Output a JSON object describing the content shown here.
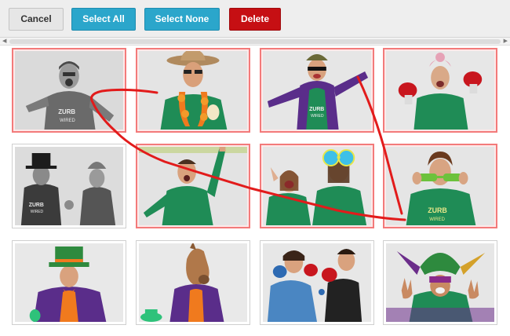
{
  "toolbar": {
    "cancel_label": "Cancel",
    "select_all_label": "Select All",
    "select_none_label": "Select None",
    "delete_label": "Delete"
  },
  "colors": {
    "accent_blue": "#2ba6cb",
    "danger_red": "#c60f13",
    "selection_border": "#f37a7a",
    "selection_bg": "#fde9e9",
    "drag_path": "#e21b1b"
  },
  "photos": [
    {
      "name": "man-gray-shirt-shouting",
      "selected": true,
      "text": "ZURB WIRED"
    },
    {
      "name": "man-cowboy-hat-leis",
      "selected": true,
      "text": ""
    },
    {
      "name": "man-purple-jacket-hat",
      "selected": true,
      "text": "ZURB WIRED"
    },
    {
      "name": "woman-boxing-gloves",
      "selected": true,
      "text": ""
    },
    {
      "name": "two-people-top-hats-bw",
      "selected": false,
      "text": "ZURB WIRED"
    },
    {
      "name": "man-pointing-green-shirt",
      "selected": true,
      "text": ""
    },
    {
      "name": "two-women-big-sunglasses",
      "selected": true,
      "text": ""
    },
    {
      "name": "man-green-glasses",
      "selected": true,
      "text": "ZURB WIRED"
    },
    {
      "name": "man-green-top-hat-purple-suit",
      "selected": false,
      "text": ""
    },
    {
      "name": "horse-mask-purple-suit",
      "selected": false,
      "text": ""
    },
    {
      "name": "two-people-boxing",
      "selected": false,
      "text": ""
    },
    {
      "name": "woman-jester-hat",
      "selected": false,
      "text": ""
    }
  ]
}
